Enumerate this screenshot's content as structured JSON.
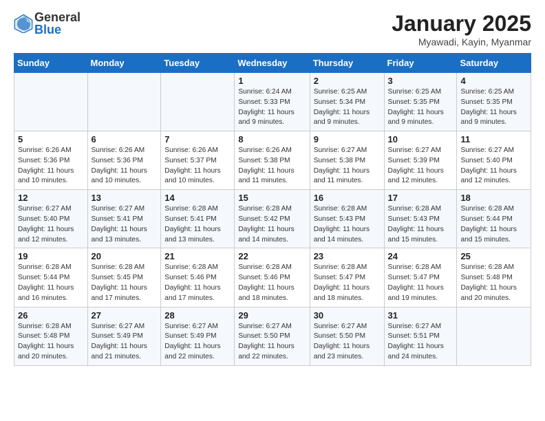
{
  "logo": {
    "general": "General",
    "blue": "Blue"
  },
  "title": "January 2025",
  "subtitle": "Myawadi, Kayin, Myanmar",
  "weekdays": [
    "Sunday",
    "Monday",
    "Tuesday",
    "Wednesday",
    "Thursday",
    "Friday",
    "Saturday"
  ],
  "weeks": [
    [
      {
        "day": "",
        "info": ""
      },
      {
        "day": "",
        "info": ""
      },
      {
        "day": "",
        "info": ""
      },
      {
        "day": "1",
        "info": "Sunrise: 6:24 AM\nSunset: 5:33 PM\nDaylight: 11 hours and 9 minutes."
      },
      {
        "day": "2",
        "info": "Sunrise: 6:25 AM\nSunset: 5:34 PM\nDaylight: 11 hours and 9 minutes."
      },
      {
        "day": "3",
        "info": "Sunrise: 6:25 AM\nSunset: 5:35 PM\nDaylight: 11 hours and 9 minutes."
      },
      {
        "day": "4",
        "info": "Sunrise: 6:25 AM\nSunset: 5:35 PM\nDaylight: 11 hours and 9 minutes."
      }
    ],
    [
      {
        "day": "5",
        "info": "Sunrise: 6:26 AM\nSunset: 5:36 PM\nDaylight: 11 hours and 10 minutes."
      },
      {
        "day": "6",
        "info": "Sunrise: 6:26 AM\nSunset: 5:36 PM\nDaylight: 11 hours and 10 minutes."
      },
      {
        "day": "7",
        "info": "Sunrise: 6:26 AM\nSunset: 5:37 PM\nDaylight: 11 hours and 10 minutes."
      },
      {
        "day": "8",
        "info": "Sunrise: 6:26 AM\nSunset: 5:38 PM\nDaylight: 11 hours and 11 minutes."
      },
      {
        "day": "9",
        "info": "Sunrise: 6:27 AM\nSunset: 5:38 PM\nDaylight: 11 hours and 11 minutes."
      },
      {
        "day": "10",
        "info": "Sunrise: 6:27 AM\nSunset: 5:39 PM\nDaylight: 11 hours and 12 minutes."
      },
      {
        "day": "11",
        "info": "Sunrise: 6:27 AM\nSunset: 5:40 PM\nDaylight: 11 hours and 12 minutes."
      }
    ],
    [
      {
        "day": "12",
        "info": "Sunrise: 6:27 AM\nSunset: 5:40 PM\nDaylight: 11 hours and 12 minutes."
      },
      {
        "day": "13",
        "info": "Sunrise: 6:27 AM\nSunset: 5:41 PM\nDaylight: 11 hours and 13 minutes."
      },
      {
        "day": "14",
        "info": "Sunrise: 6:28 AM\nSunset: 5:41 PM\nDaylight: 11 hours and 13 minutes."
      },
      {
        "day": "15",
        "info": "Sunrise: 6:28 AM\nSunset: 5:42 PM\nDaylight: 11 hours and 14 minutes."
      },
      {
        "day": "16",
        "info": "Sunrise: 6:28 AM\nSunset: 5:43 PM\nDaylight: 11 hours and 14 minutes."
      },
      {
        "day": "17",
        "info": "Sunrise: 6:28 AM\nSunset: 5:43 PM\nDaylight: 11 hours and 15 minutes."
      },
      {
        "day": "18",
        "info": "Sunrise: 6:28 AM\nSunset: 5:44 PM\nDaylight: 11 hours and 15 minutes."
      }
    ],
    [
      {
        "day": "19",
        "info": "Sunrise: 6:28 AM\nSunset: 5:44 PM\nDaylight: 11 hours and 16 minutes."
      },
      {
        "day": "20",
        "info": "Sunrise: 6:28 AM\nSunset: 5:45 PM\nDaylight: 11 hours and 17 minutes."
      },
      {
        "day": "21",
        "info": "Sunrise: 6:28 AM\nSunset: 5:46 PM\nDaylight: 11 hours and 17 minutes."
      },
      {
        "day": "22",
        "info": "Sunrise: 6:28 AM\nSunset: 5:46 PM\nDaylight: 11 hours and 18 minutes."
      },
      {
        "day": "23",
        "info": "Sunrise: 6:28 AM\nSunset: 5:47 PM\nDaylight: 11 hours and 18 minutes."
      },
      {
        "day": "24",
        "info": "Sunrise: 6:28 AM\nSunset: 5:47 PM\nDaylight: 11 hours and 19 minutes."
      },
      {
        "day": "25",
        "info": "Sunrise: 6:28 AM\nSunset: 5:48 PM\nDaylight: 11 hours and 20 minutes."
      }
    ],
    [
      {
        "day": "26",
        "info": "Sunrise: 6:28 AM\nSunset: 5:48 PM\nDaylight: 11 hours and 20 minutes."
      },
      {
        "day": "27",
        "info": "Sunrise: 6:27 AM\nSunset: 5:49 PM\nDaylight: 11 hours and 21 minutes."
      },
      {
        "day": "28",
        "info": "Sunrise: 6:27 AM\nSunset: 5:49 PM\nDaylight: 11 hours and 22 minutes."
      },
      {
        "day": "29",
        "info": "Sunrise: 6:27 AM\nSunset: 5:50 PM\nDaylight: 11 hours and 22 minutes."
      },
      {
        "day": "30",
        "info": "Sunrise: 6:27 AM\nSunset: 5:50 PM\nDaylight: 11 hours and 23 minutes."
      },
      {
        "day": "31",
        "info": "Sunrise: 6:27 AM\nSunset: 5:51 PM\nDaylight: 11 hours and 24 minutes."
      },
      {
        "day": "",
        "info": ""
      }
    ]
  ]
}
